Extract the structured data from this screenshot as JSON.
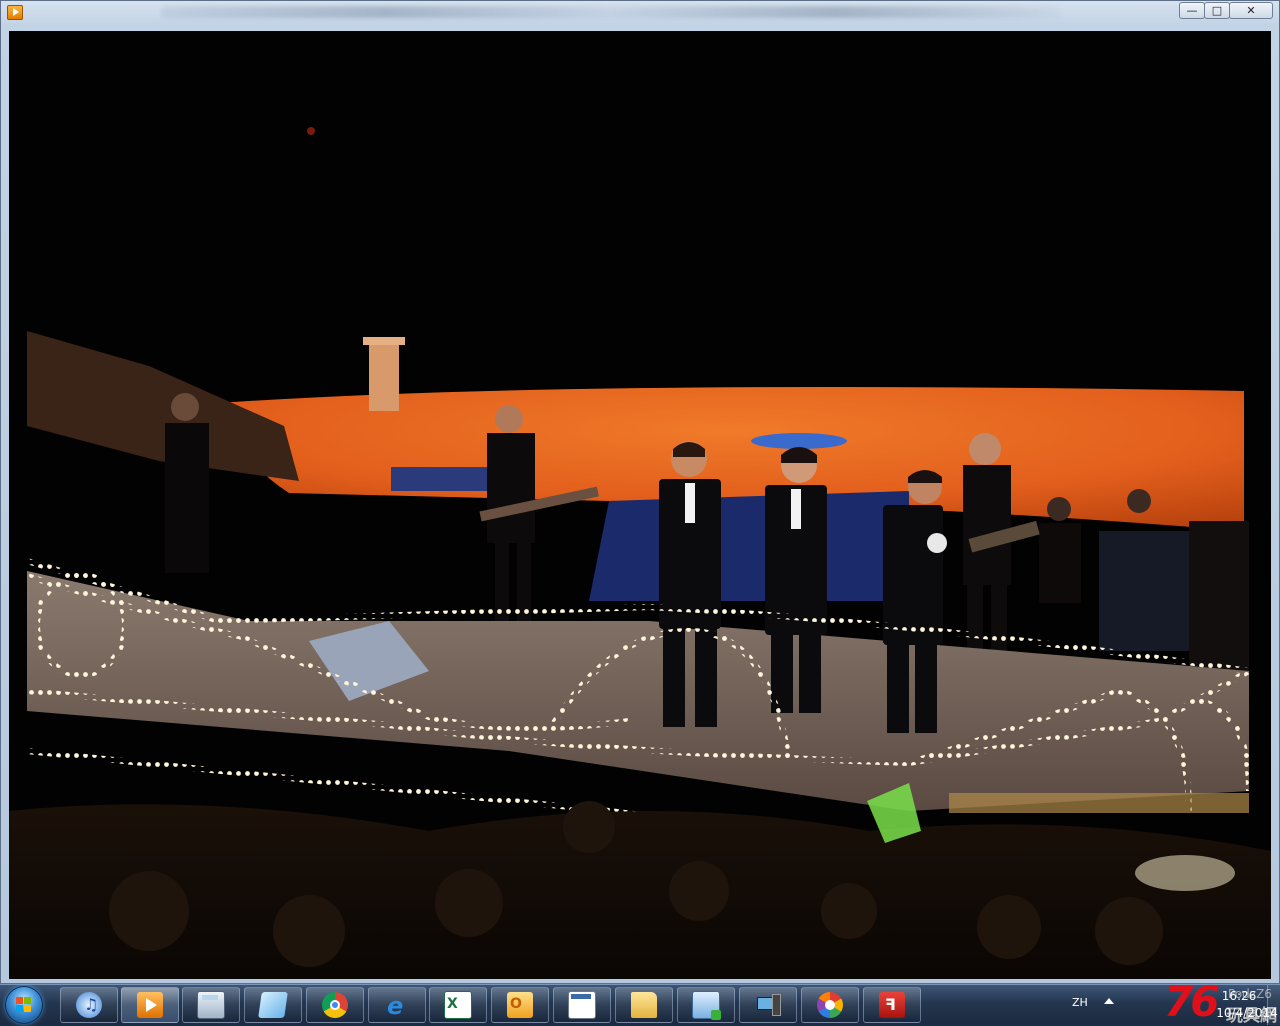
{
  "window": {
    "title": "",
    "controls": {
      "minimize": "—",
      "maximize": "□",
      "close": "✕"
    }
  },
  "video": {
    "scene": "concert stage",
    "colors": {
      "stage": "#e8641e",
      "lights": "#f4ecd2",
      "background": "#030202"
    }
  },
  "taskbar": {
    "start": {
      "icon": "windows-flag-icon"
    },
    "pinned": [
      {
        "name": "itunes",
        "icon": "itunes-icon",
        "active": false
      },
      {
        "name": "media-player",
        "icon": "media-player-icon",
        "active": true
      },
      {
        "name": "calculator",
        "icon": "calculator-icon",
        "active": false
      },
      {
        "name": "notepad",
        "icon": "notepad-icon",
        "active": false
      },
      {
        "name": "chrome",
        "icon": "chrome-icon",
        "active": false
      },
      {
        "name": "internet-explorer",
        "icon": "ie-icon",
        "active": false
      },
      {
        "name": "excel",
        "icon": "excel-icon",
        "active": false
      },
      {
        "name": "outlook",
        "icon": "outlook-icon",
        "active": false
      },
      {
        "name": "window-app",
        "icon": "window-icon",
        "active": false
      },
      {
        "name": "explorer",
        "icon": "folder-icon",
        "active": false
      },
      {
        "name": "remote-desktop",
        "icon": "remote-desktop-icon",
        "active": false
      },
      {
        "name": "device-manager",
        "icon": "device-icon",
        "active": false
      },
      {
        "name": "picasa",
        "icon": "picasa-icon",
        "active": false
      },
      {
        "name": "acrobat",
        "icon": "acrobat-icon",
        "active": false
      }
    ],
    "tray": {
      "language": "ZH",
      "time": "16:26",
      "date": "10/4/2014",
      "watermark_brand": "76",
      "watermark_text": "PodzZ6",
      "watermark_cn": "玩具網"
    }
  }
}
